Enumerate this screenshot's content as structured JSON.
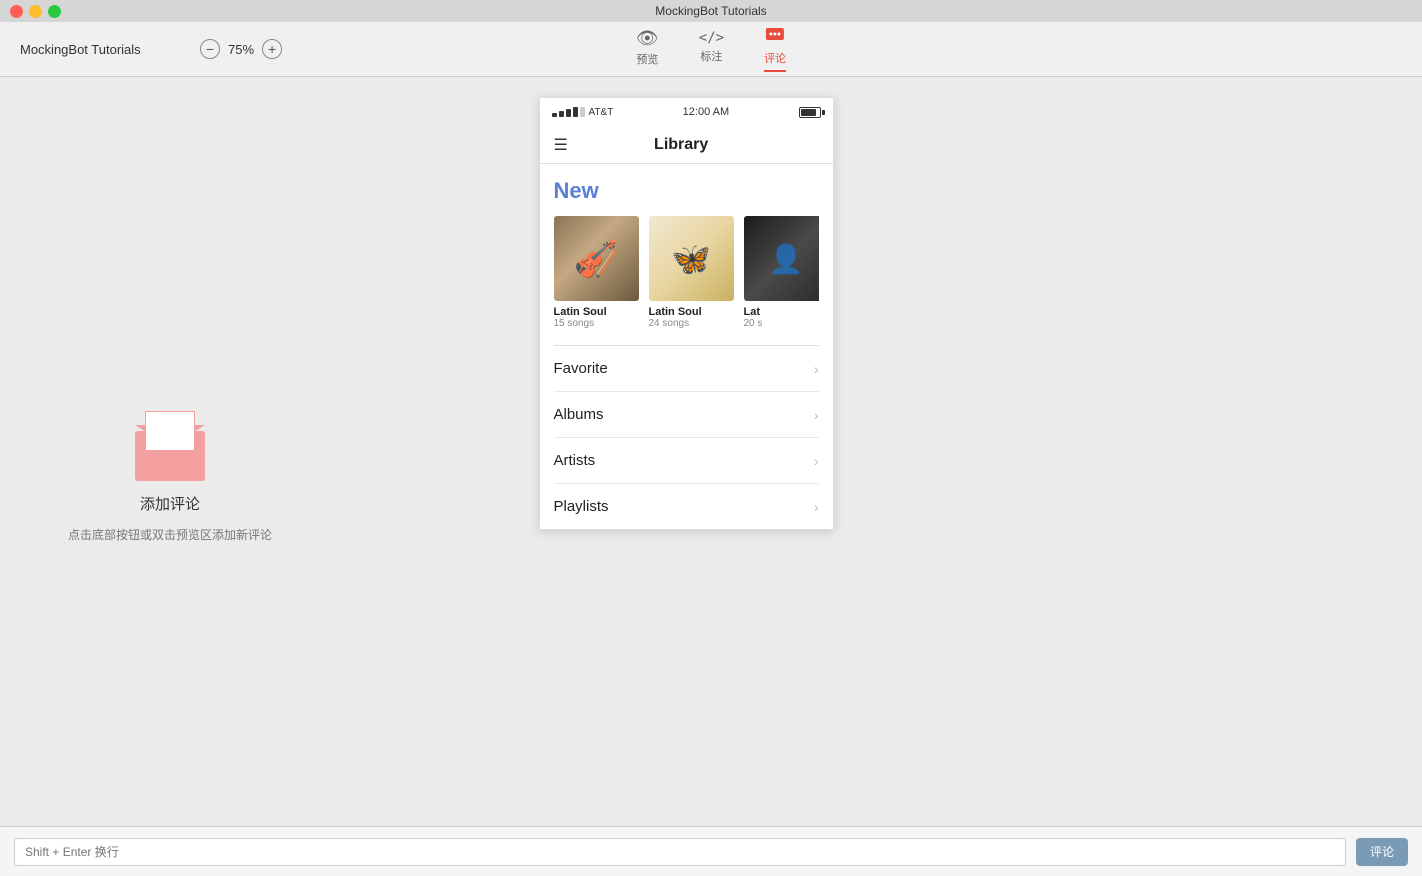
{
  "window": {
    "title": "MockingBot Tutorials"
  },
  "title_bar": {
    "text": "MockingBot Tutorials"
  },
  "toolbar": {
    "app_name": "MockingBot Tutorials",
    "zoom_level": "75%",
    "nav_items": [
      {
        "id": "preview",
        "label": "预览",
        "icon": "👁",
        "active": false
      },
      {
        "id": "markup",
        "label": "标注",
        "icon": "</>",
        "active": false
      },
      {
        "id": "comment",
        "label": "评论",
        "icon": "💬",
        "active": true
      }
    ]
  },
  "left_panel": {
    "empty_title": "添加评论",
    "empty_subtitle": "点击底部按钮或双击预览区添加新评论"
  },
  "phone": {
    "status_bar": {
      "carrier": "AT&T",
      "time": "12:00 AM"
    },
    "nav_bar": {
      "title": "Library"
    },
    "new_section": {
      "label": "New",
      "albums": [
        {
          "name": "Latin Soul",
          "songs": "15 songs"
        },
        {
          "name": "Latin Soul",
          "songs": "24 songs"
        },
        {
          "name": "Lat",
          "songs": "20 s"
        }
      ]
    },
    "list_items": [
      {
        "label": "Favorite"
      },
      {
        "label": "Albums"
      },
      {
        "label": "Artists"
      },
      {
        "label": "Playlists"
      }
    ]
  },
  "bottom_bar": {
    "input_placeholder": "Shift + Enter 换行",
    "submit_label": "评论"
  }
}
